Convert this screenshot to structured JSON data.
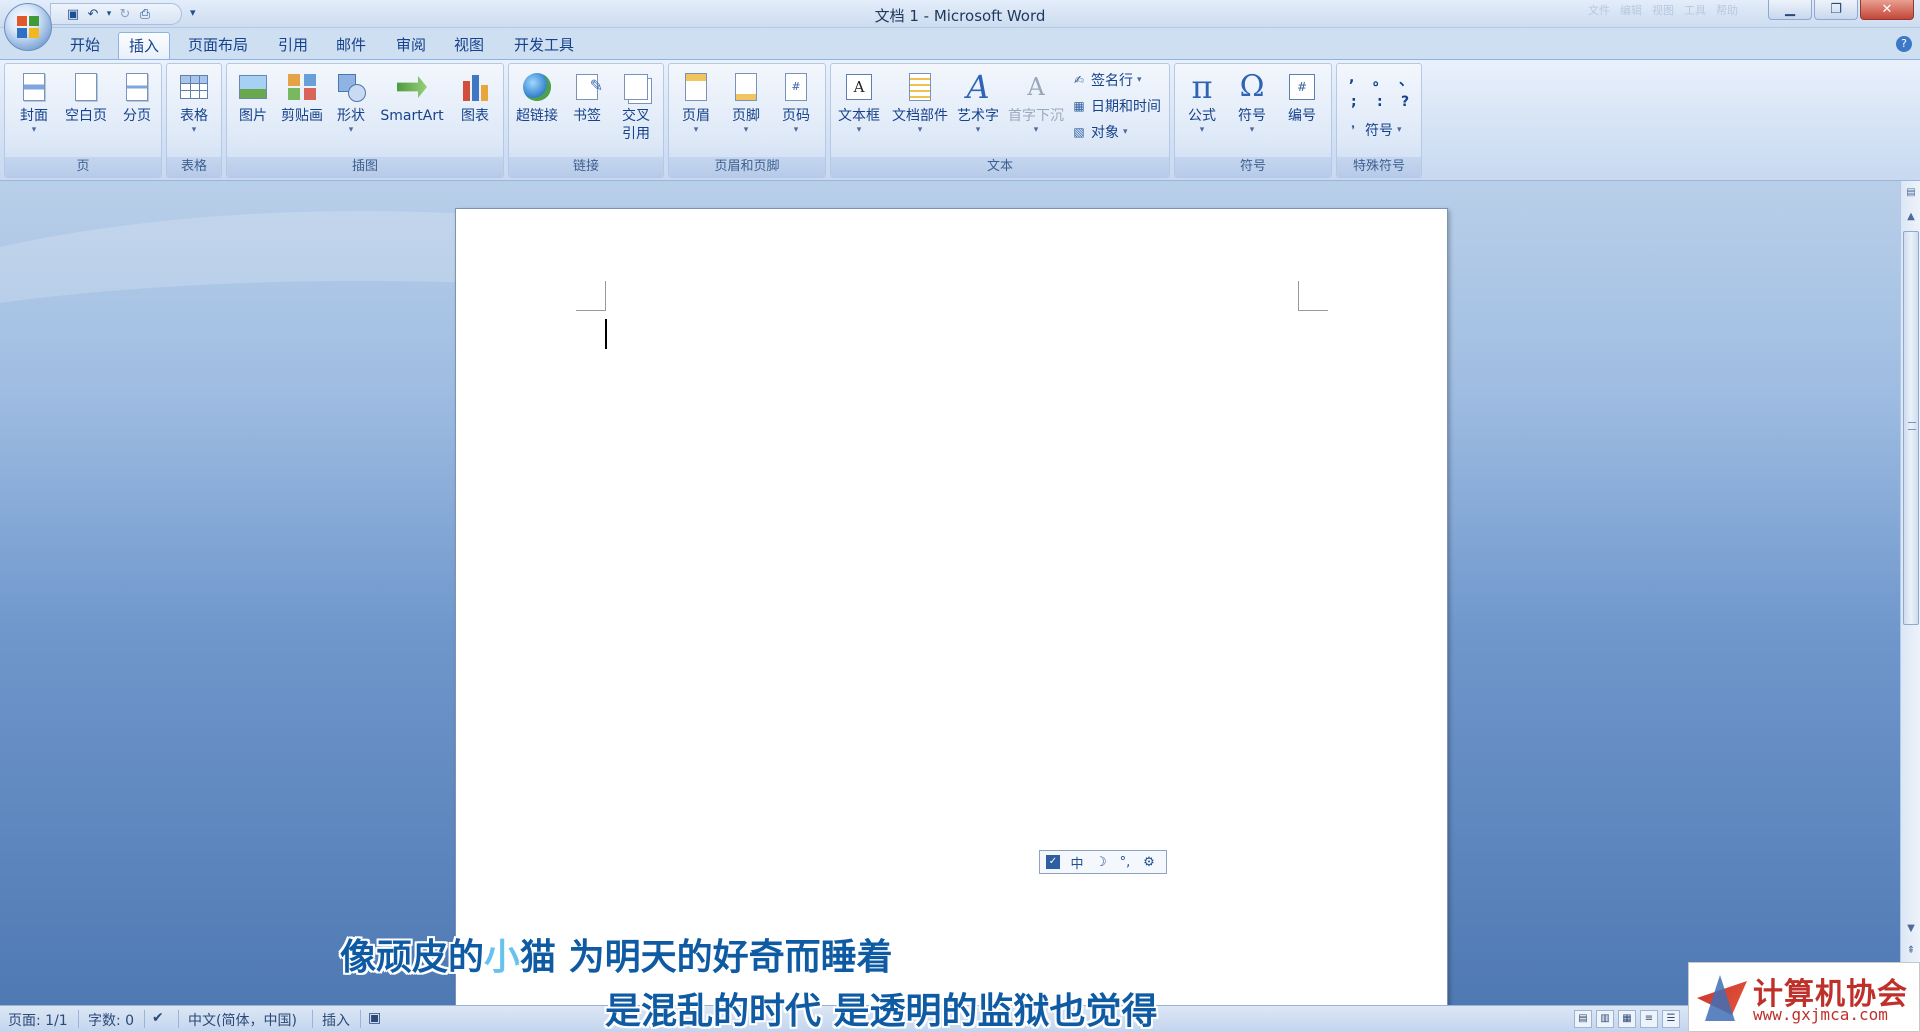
{
  "app": {
    "title": "文档 1 - Microsoft Word",
    "faint_right_labels": [
      "文件",
      "编辑",
      "视图",
      "工具",
      "帮助"
    ]
  },
  "qat": {
    "icons": [
      "save-icon",
      "undo-icon",
      "undo-dropdown-icon",
      "redo-icon",
      "print-preview-icon"
    ],
    "customize_glyph": "▾"
  },
  "tabs": [
    {
      "label": "开始"
    },
    {
      "label": "插入",
      "active": true
    },
    {
      "label": "页面布局"
    },
    {
      "label": "引用"
    },
    {
      "label": "邮件"
    },
    {
      "label": "审阅"
    },
    {
      "label": "视图"
    },
    {
      "label": "开发工具"
    }
  ],
  "ribbon": {
    "groups": {
      "page": "页",
      "table": "表格",
      "illustrations": "插图",
      "links": "链接",
      "header_footer": "页眉和页脚",
      "text": "文本",
      "symbols": "符号",
      "special_symbols": "特殊符号"
    },
    "buttons": {
      "cover": "封面",
      "blank_page": "空白页",
      "page_break": "分页",
      "table": "表格",
      "picture": "图片",
      "clip_art": "剪贴画",
      "shapes": "形状",
      "smartart": "SmartArt",
      "chart": "图表",
      "hyperlink": "超链接",
      "bookmark": "书签",
      "cross_ref_line1": "交叉",
      "cross_ref_line2": "引用",
      "header": "页眉",
      "footer": "页脚",
      "page_number": "页码",
      "text_box": "文本框",
      "quick_parts": "文档部件",
      "word_art": "艺术字",
      "drop_cap": "首字下沉",
      "signature_line": "签名行",
      "date_time": "日期和时间",
      "object": "对象",
      "equation": "公式",
      "symbol": "符号",
      "number": "编号",
      "special_symbol": "符号"
    },
    "glyphs": {
      "pi": "π",
      "omega": "Ω",
      "hash": "#",
      "textbox_a": "A",
      "wordart_a": "A",
      "dropcap_a": "A",
      "dropdown": "▾"
    },
    "punctuation": [
      ",",
      "。",
      "、",
      ";",
      ":",
      "?"
    ]
  },
  "document": {
    "ime_bar": [
      "✓",
      "中",
      "☽",
      "°,",
      "⚙"
    ]
  },
  "statusbar": {
    "page": "页面: 1/1",
    "words": "字数: 0",
    "language": "中文(简体，中国)",
    "mode": "插入"
  },
  "subtitles": {
    "line1_a": "像顽皮的",
    "line1_b": "小",
    "line1_c": "猫  为明天的好奇而睡着",
    "line2": "是混乱的时代  是透明的监狱也觉得"
  },
  "watermark": {
    "title": "计算机协会",
    "url": "www.gxjmca.com"
  },
  "colors": {
    "ribbon_text": "#15428b",
    "subtitle_main": "#0e5aa3",
    "subtitle_highlight": "#66c3ee",
    "watermark": "#c0302a"
  }
}
